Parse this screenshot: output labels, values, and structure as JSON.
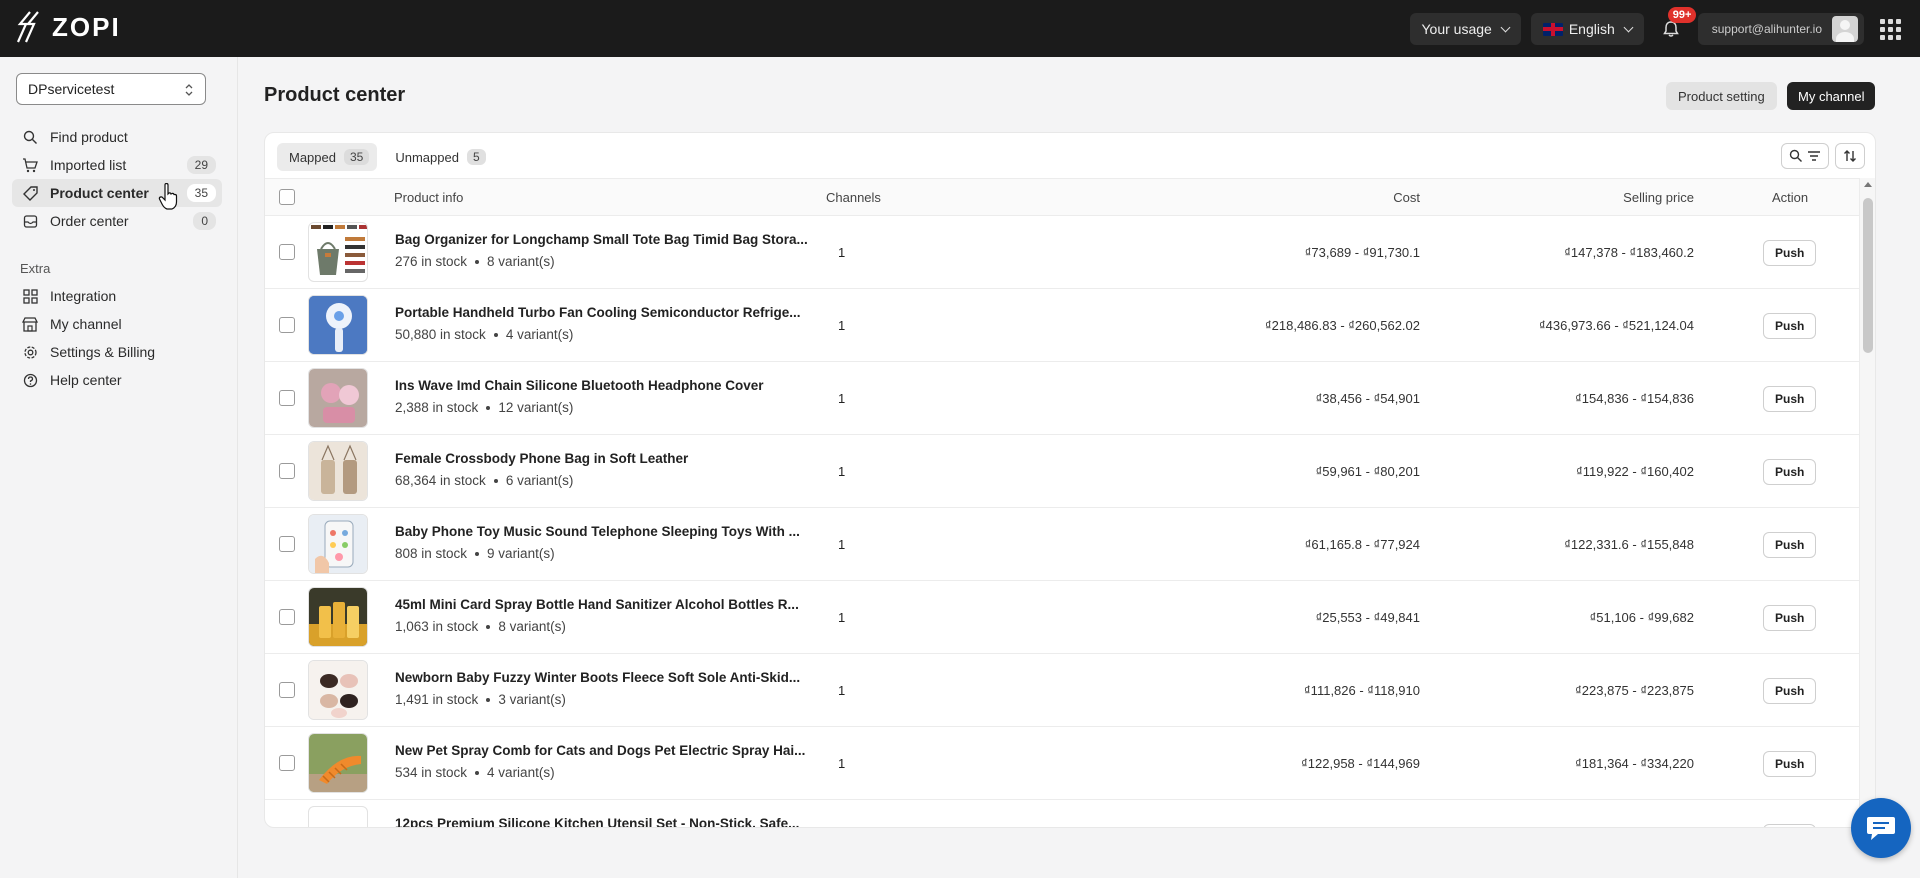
{
  "brand": {
    "name": "ZOPI"
  },
  "topbar": {
    "usage_label": "Your usage",
    "language_label": "English",
    "notification_badge": "99+",
    "account_email": "support@alihunter.io"
  },
  "sidebar": {
    "store": "DPservicetest",
    "items": [
      {
        "label": "Find product",
        "icon": "search-icon",
        "count": ""
      },
      {
        "label": "Imported list",
        "icon": "cart-icon",
        "count": "29"
      },
      {
        "label": "Product center",
        "icon": "tag-icon",
        "count": "35",
        "active": true
      },
      {
        "label": "Order center",
        "icon": "inbox-icon",
        "count": "0"
      }
    ],
    "extra_label": "Extra",
    "extra_items": [
      {
        "label": "Integration",
        "icon": "grid-icon"
      },
      {
        "label": "My channel",
        "icon": "store-icon"
      },
      {
        "label": "Settings & Billing",
        "icon": "gear-icon"
      },
      {
        "label": "Help center",
        "icon": "help-icon"
      }
    ]
  },
  "main": {
    "title": "Product center",
    "product_setting_label": "Product setting",
    "my_channel_label": "My channel",
    "tabs": [
      {
        "label": "Mapped",
        "count": "35",
        "active": true
      },
      {
        "label": "Unmapped",
        "count": "5"
      }
    ],
    "columns": {
      "product_info": "Product info",
      "channels": "Channels",
      "cost": "Cost",
      "selling_price": "Selling price",
      "action": "Action"
    },
    "push_label": "Push",
    "products": [
      {
        "name": "Bag Organizer for Longchamp Small Tote Bag Timid Bag Stora...",
        "stock": "276 in stock",
        "variants": "8 variant(s)",
        "channels": "1",
        "cost": "₫73,689 - ₫91,730.1",
        "price": "₫147,378 - ₫183,460.2"
      },
      {
        "name": "Portable Handheld Turbo Fan Cooling Semiconductor Refrige...",
        "stock": "50,880 in stock",
        "variants": "4 variant(s)",
        "channels": "1",
        "cost": "₫218,486.83 - ₫260,562.02",
        "price": "₫436,973.66 - ₫521,124.04"
      },
      {
        "name": "Ins Wave Imd Chain Silicone Bluetooth Headphone Cover",
        "stock": "2,388 in stock",
        "variants": "12 variant(s)",
        "channels": "1",
        "cost": "₫38,456 - ₫54,901",
        "price": "₫154,836 - ₫154,836"
      },
      {
        "name": "Female Crossbody Phone Bag in Soft Leather",
        "stock": "68,364 in stock",
        "variants": "6 variant(s)",
        "channels": "1",
        "cost": "₫59,961 - ₫80,201",
        "price": "₫119,922 - ₫160,402"
      },
      {
        "name": "Baby Phone Toy Music Sound Telephone Sleeping Toys With ...",
        "stock": "808 in stock",
        "variants": "9 variant(s)",
        "channels": "1",
        "cost": "₫61,165.8 - ₫77,924",
        "price": "₫122,331.6 - ₫155,848"
      },
      {
        "name": "45ml Mini Card Spray Bottle Hand Sanitizer Alcohol Bottles R...",
        "stock": "1,063 in stock",
        "variants": "8 variant(s)",
        "channels": "1",
        "cost": "₫25,553 - ₫49,841",
        "price": "₫51,106 - ₫99,682"
      },
      {
        "name": "Newborn Baby Fuzzy Winter Boots Fleece Soft Sole Anti-Skid...",
        "stock": "1,491 in stock",
        "variants": "3 variant(s)",
        "channels": "1",
        "cost": "₫111,826 - ₫118,910",
        "price": "₫223,875 - ₫223,875"
      },
      {
        "name": "New Pet Spray Comb for Cats and Dogs Pet Electric Spray Hai...",
        "stock": "534 in stock",
        "variants": "4 variant(s)",
        "channels": "1",
        "cost": "₫122,958 - ₫144,969",
        "price": "₫181,364 - ₫334,220"
      },
      {
        "name": "12pcs Premium Silicone Kitchen Utensil Set - Non-Stick, Safe...",
        "stock": "",
        "variants": "",
        "channels": "",
        "cost": "",
        "price": ""
      }
    ]
  },
  "colors": {
    "topbar": "#1b1b1b",
    "accent_dark": "#222222",
    "badge_red": "#e0312b",
    "chat_blue": "#1565c0"
  }
}
